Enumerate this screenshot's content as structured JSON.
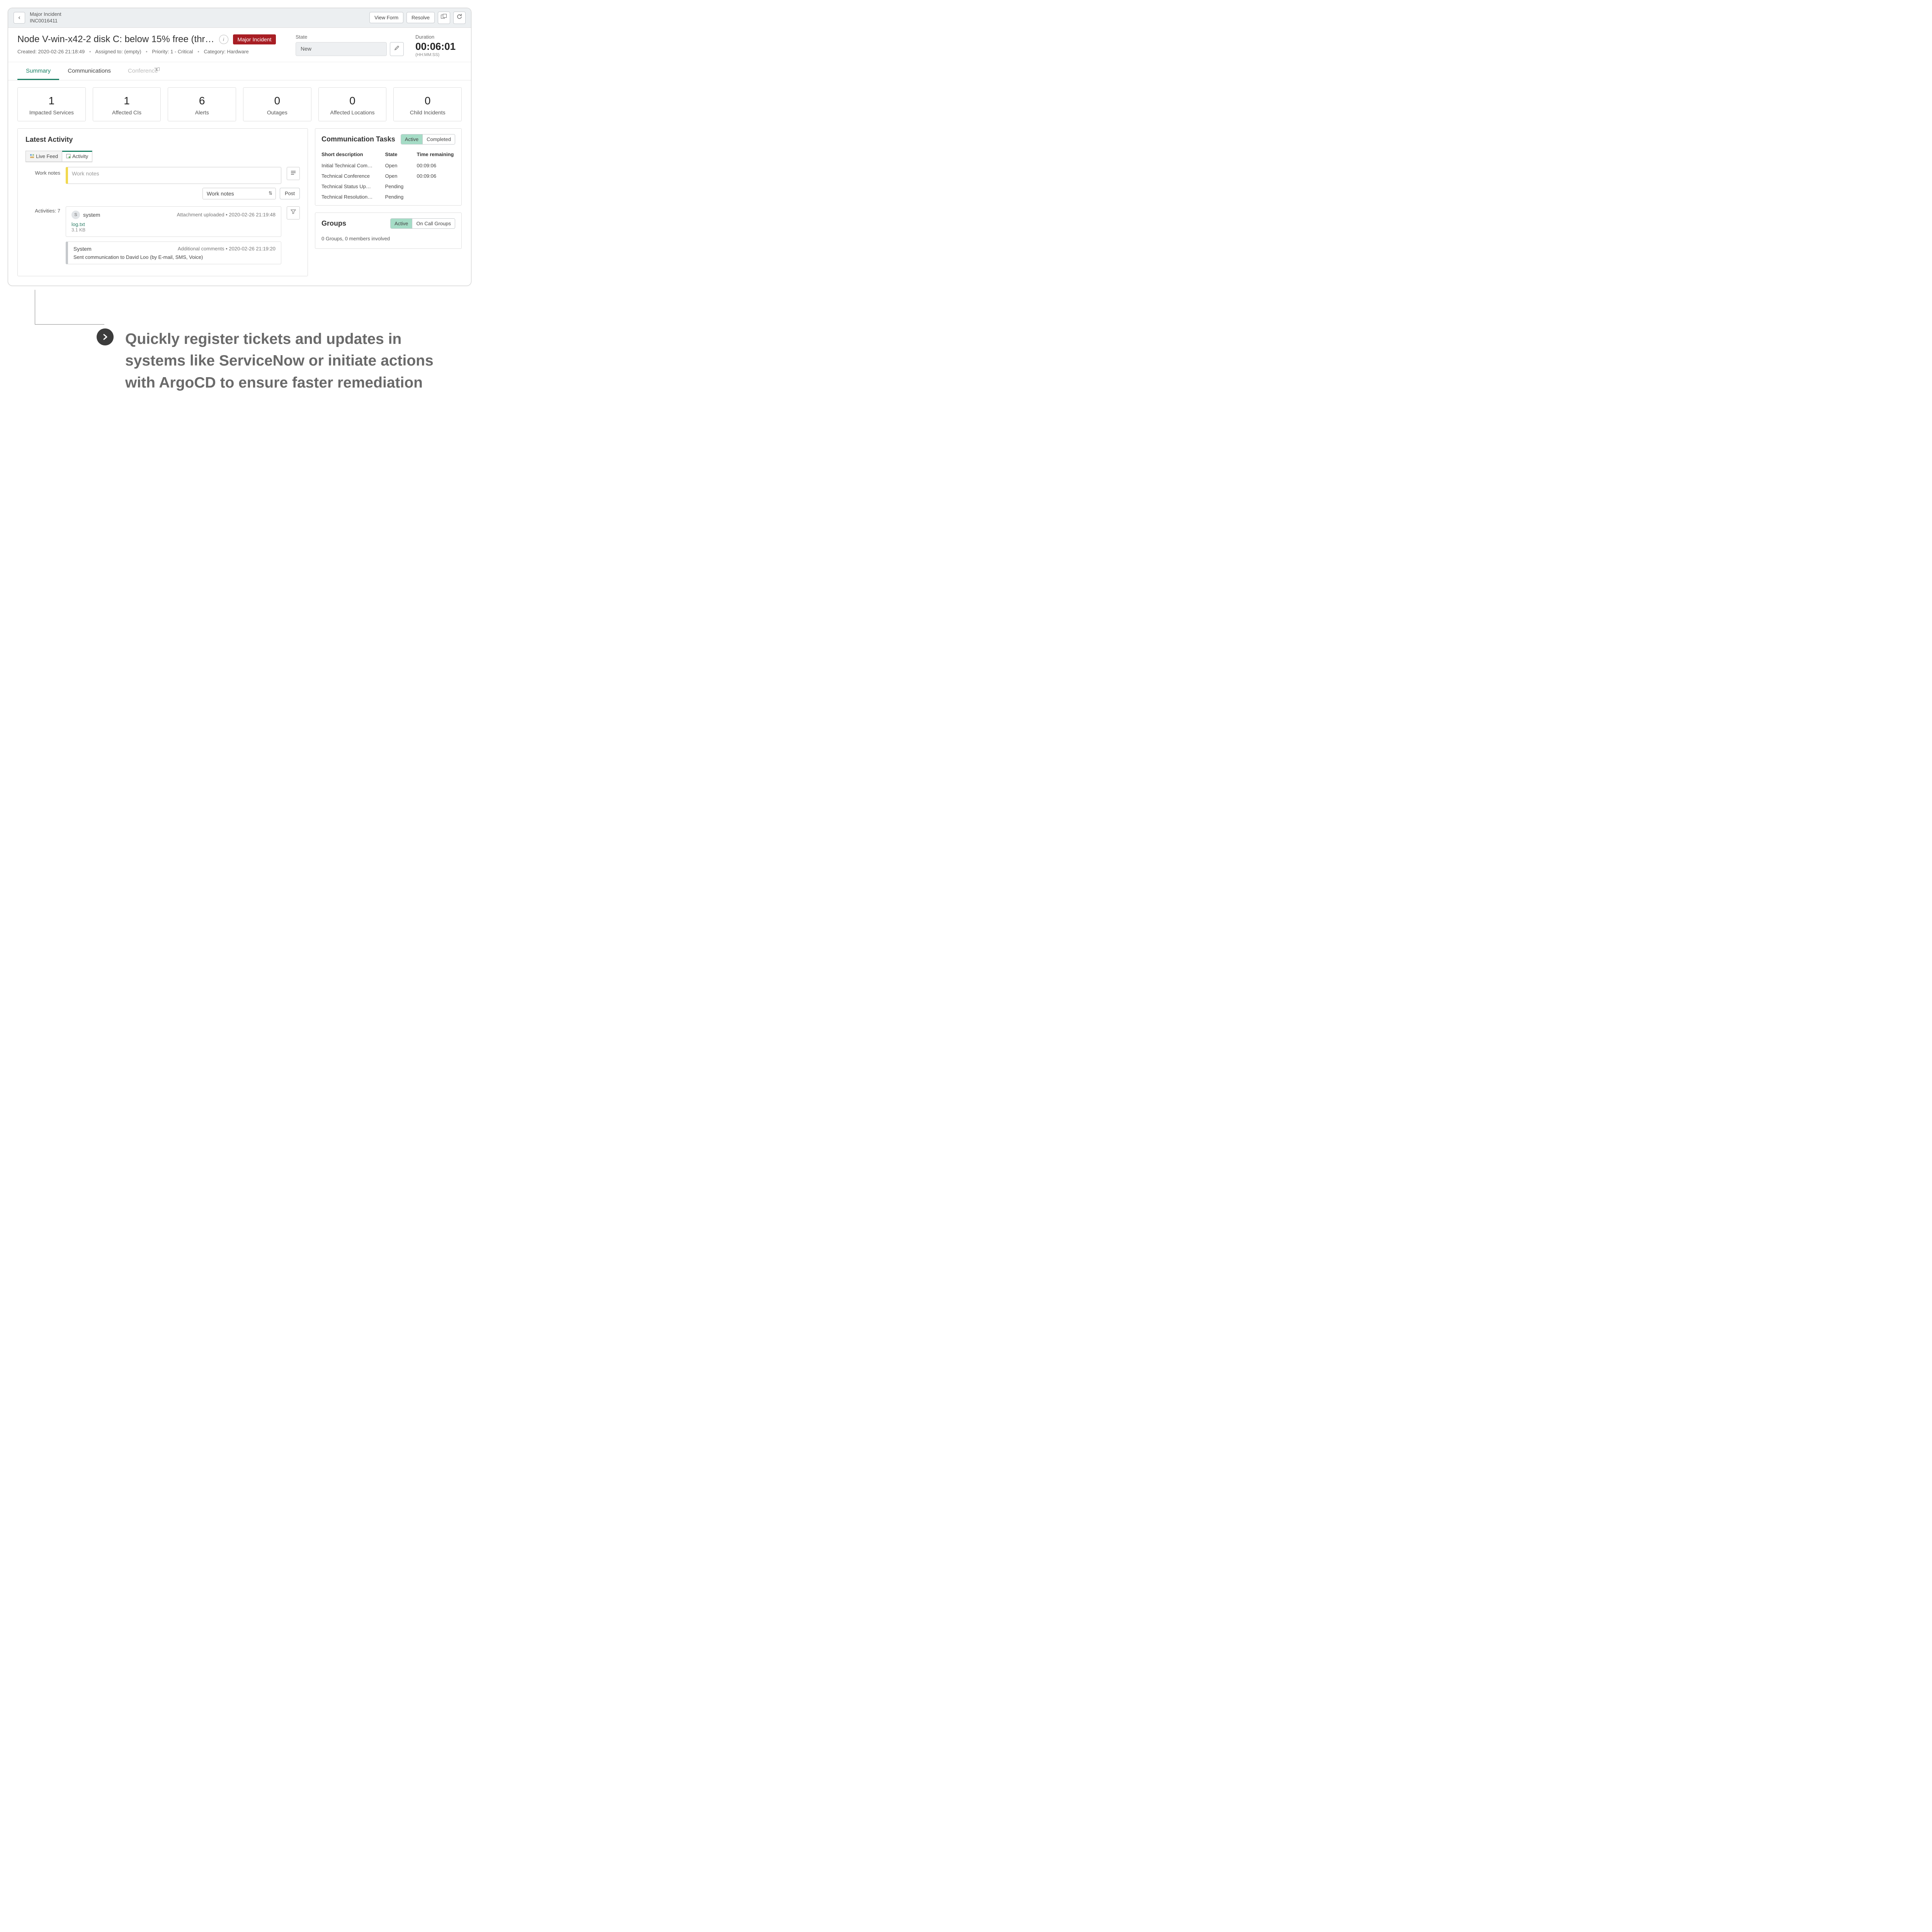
{
  "topbar": {
    "crumb_title": "Major Incident",
    "crumb_id": "INC0016411",
    "view_form": "View Form",
    "resolve": "Resolve"
  },
  "header": {
    "title": "Node V-win-x42-2 disk C: below 15% free (thr…",
    "badge": "Major Incident",
    "meta": {
      "created_label": "Created:",
      "created_value": "2020-02-26 21:18:49",
      "assigned_label": "Assigned to:",
      "assigned_value": "(empty)",
      "priority_label": "Priority:",
      "priority_value": "1 - Critical",
      "category_label": "Category:",
      "category_value": "Hardware"
    },
    "state_label": "State",
    "state_value": "New",
    "duration_label": "Duration",
    "duration_value": "00:06:01",
    "duration_format": "(HH:MM:SS)"
  },
  "tabs": [
    "Summary",
    "Communications",
    "Conference"
  ],
  "kpis": [
    {
      "num": "1",
      "lab": "Impacted Services"
    },
    {
      "num": "1",
      "lab": "Affected CIs"
    },
    {
      "num": "6",
      "lab": "Alerts"
    },
    {
      "num": "0",
      "lab": "Outages"
    },
    {
      "num": "0",
      "lab": "Affected Locations"
    },
    {
      "num": "0",
      "lab": "Child Incidents"
    }
  ],
  "activity": {
    "title": "Latest Activity",
    "subtabs": {
      "live": "Live Feed",
      "activity": "Activity"
    },
    "work_notes_label": "Work notes",
    "work_notes_placeholder": "Work notes",
    "select_value": "Work notes",
    "post": "Post",
    "activities_label": "Activities: 7",
    "items": [
      {
        "avatar": "S",
        "user": "system",
        "meta": "Attachment uploaded   •   2020-02-26 21:19:48",
        "link": "log.txt",
        "sub": "3.1 KB"
      },
      {
        "user": "System",
        "meta": "Additional comments   •   2020-02-26 21:19:20",
        "body": "Sent communication to David Loo (by E-mail, SMS, Voice)"
      }
    ]
  },
  "comm_tasks": {
    "title": "Communication Tasks",
    "toggle_active": "Active",
    "toggle_completed": "Completed",
    "cols": {
      "desc": "Short description",
      "state": "State",
      "time": "Time remaining"
    },
    "rows": [
      {
        "desc": "Initial Technical Communication",
        "state": "Open",
        "time": "00:09:06"
      },
      {
        "desc": "Technical Conference",
        "state": "Open",
        "time": "00:09:06"
      },
      {
        "desc": "Technical Status Update",
        "state": "Pending",
        "time": ""
      },
      {
        "desc": "Technical Resolution Communic…",
        "state": "Pending",
        "time": ""
      }
    ]
  },
  "groups": {
    "title": "Groups",
    "toggle_active": "Active",
    "toggle_oncall": "On Call Groups",
    "body": "0 Groups, 0 members involved"
  },
  "callout": "Quickly register tickets and updates in systems like ServiceNow or initiate actions with ArgoCD to ensure faster remediation"
}
